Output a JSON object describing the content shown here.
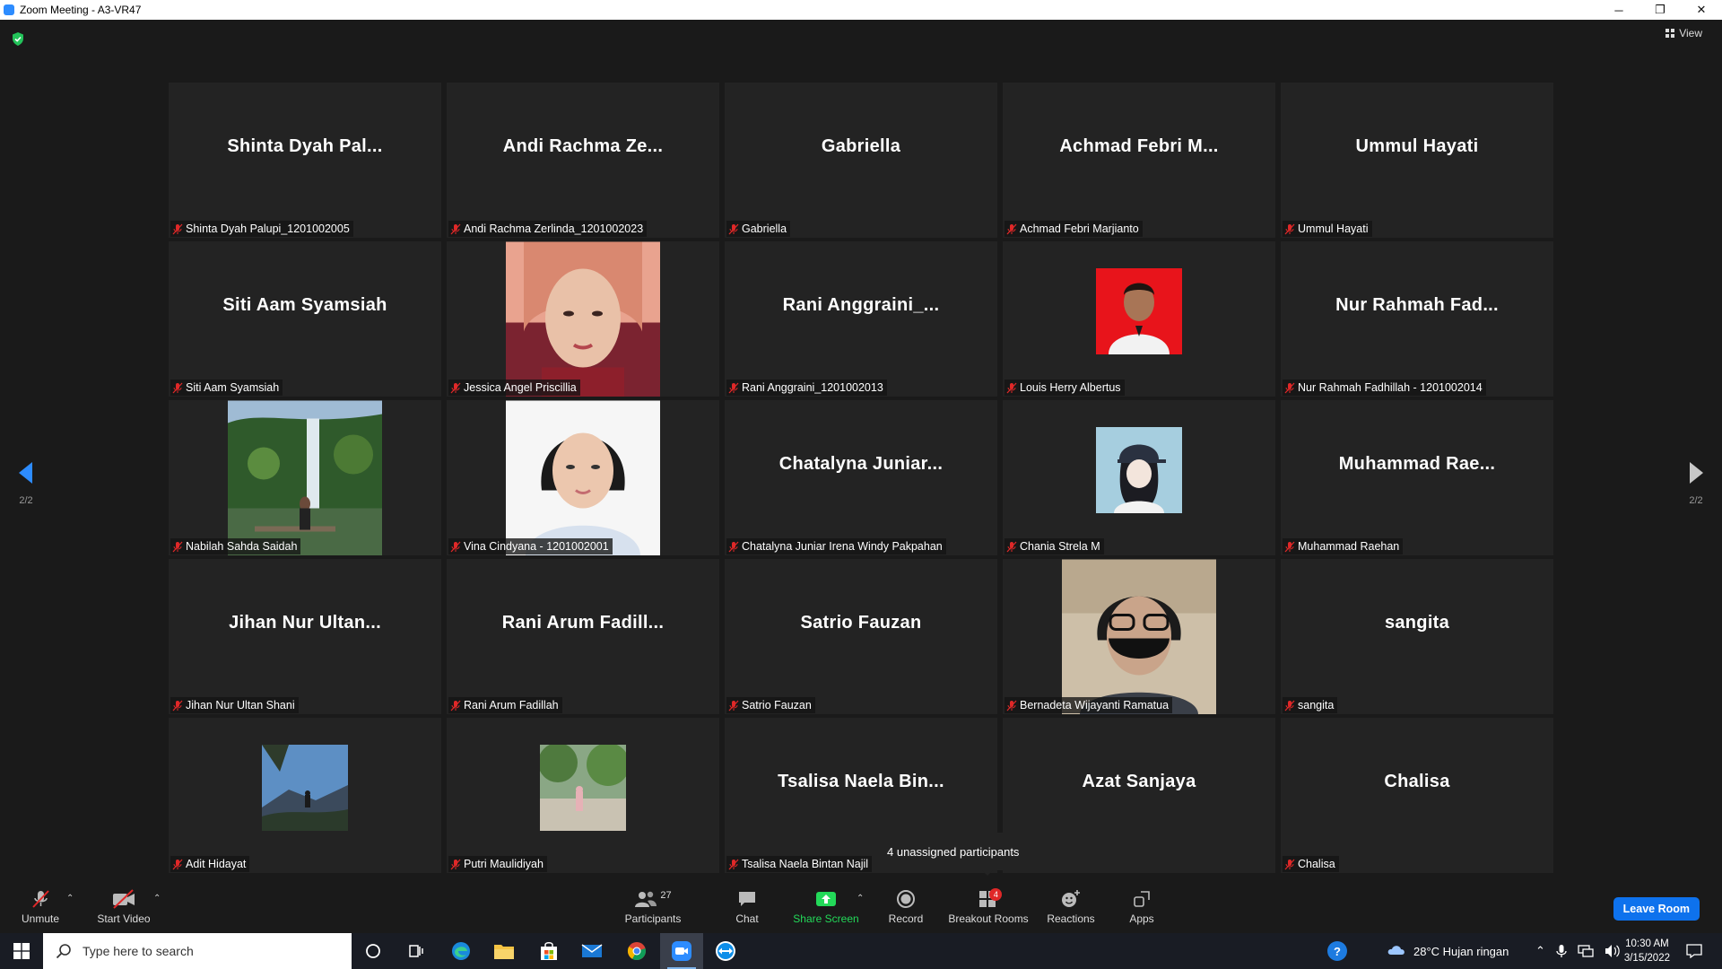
{
  "window": {
    "title": "Zoom Meeting - A3-VR47",
    "minimize": "─",
    "restore": "❐",
    "close": "✕"
  },
  "top": {
    "view_label": "View"
  },
  "pager": {
    "left": "2/2",
    "right": "2/2"
  },
  "tiles": [
    {
      "display": "Shinta Dyah Pal...",
      "label": "Shinta Dyah Palupi_1201002005",
      "photo": null
    },
    {
      "display": "Andi Rachma Ze...",
      "label": "Andi Rachma Zerlinda_1201002023",
      "photo": null
    },
    {
      "display": "Gabriella",
      "label": "Gabriella",
      "photo": null
    },
    {
      "display": "Achmad Febri M...",
      "label": "Achmad Febri Marjianto",
      "photo": null
    },
    {
      "display": "Ummul Hayati",
      "label": "Ummul Hayati",
      "photo": null
    },
    {
      "display": "Siti Aam Syamsiah",
      "label": "Siti Aam Syamsiah",
      "photo": null
    },
    {
      "display": "",
      "label": "Jessica Angel Priscillia",
      "photo": "portrait-pink"
    },
    {
      "display": "Rani Anggraini_...",
      "label": "Rani Anggraini_1201002013",
      "photo": null
    },
    {
      "display": "",
      "label": "Louis Herry Albertus",
      "photo": "portrait-red-small"
    },
    {
      "display": "Nur Rahmah Fad...",
      "label": "Nur Rahmah Fadhillah - 1201002014",
      "photo": null
    },
    {
      "display": "",
      "label": "Nabilah Sahda Saidah",
      "photo": "waterfall"
    },
    {
      "display": "",
      "label": "Vina Cindyana - 1201002001",
      "photo": "portrait-white"
    },
    {
      "display": "Chatalyna Juniar...",
      "label": "Chatalyna Juniar Irena Windy Pakpahan",
      "photo": null
    },
    {
      "display": "",
      "label": "Chania Strela M",
      "photo": "anime-small"
    },
    {
      "display": "Muhammad Rae...",
      "label": "Muhammad Raehan",
      "photo": null
    },
    {
      "display": "Jihan Nur Ultan...",
      "label": "Jihan Nur Ultan Shani",
      "photo": null
    },
    {
      "display": "Rani Arum Fadill...",
      "label": "Rani Arum Fadillah",
      "photo": null
    },
    {
      "display": "Satrio Fauzan",
      "label": "Satrio Fauzan",
      "photo": null
    },
    {
      "display": "",
      "label": "Bernadeta Wijayanti Ramatua",
      "photo": "masked-person"
    },
    {
      "display": "sangita",
      "label": "sangita",
      "photo": null
    },
    {
      "display": "",
      "label": "Adit Hidayat",
      "photo": "mountain-small"
    },
    {
      "display": "",
      "label": "Putri Maulidiyah",
      "photo": "park-small"
    },
    {
      "display": "Tsalisa Naela Bin...",
      "label": "Tsalisa Naela Bintan Najil",
      "photo": null
    },
    {
      "display": "Azat Sanjaya",
      "label": "",
      "photo": null
    },
    {
      "display": "Chalisa",
      "label": "Chalisa",
      "photo": null
    }
  ],
  "tooltip": "4 unassigned participants",
  "toolbar": {
    "unmute": "Unmute",
    "start_video": "Start Video",
    "participants": "Participants",
    "participants_count": "27",
    "chat": "Chat",
    "share_screen": "Share Screen",
    "record": "Record",
    "breakout_rooms": "Breakout Rooms",
    "breakout_badge": "4",
    "reactions": "Reactions",
    "apps": "Apps",
    "leave": "Leave Room"
  },
  "taskbar": {
    "search_placeholder": "Type here to search",
    "weather": "28°C  Hujan ringan",
    "time": "10:30 AM",
    "date": "3/15/2022",
    "help": "?"
  },
  "colors": {
    "accent": "#0e72ed",
    "share_green": "#23d959",
    "mic_off_red": "#e02828",
    "badge_red": "#e02828"
  }
}
